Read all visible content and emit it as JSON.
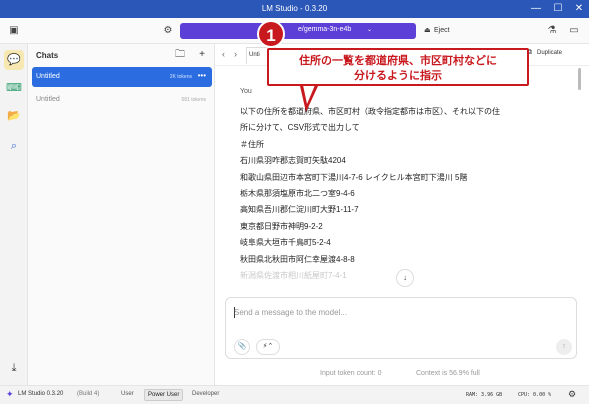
{
  "window": {
    "title": "LM Studio - 0.3.20",
    "min_icon": "—",
    "max_icon": "☐",
    "close_icon": "✕"
  },
  "toolbar": {
    "sidebar_toggle_icon": "▣",
    "settings_icon": "⚙",
    "model_name": "e/gemma-3n-e4b",
    "model_chevron": "⌄",
    "eject_icon": "⏏",
    "eject_label": "Eject",
    "accent": "#5b3fd6",
    "right_icon_1": "⚗",
    "right_icon_2": "▭"
  },
  "rail": {
    "chat_icon": "💬",
    "terminal_icon": "⌨",
    "folder_icon": "📂",
    "search_icon": "⌕",
    "download_icon": "⤓"
  },
  "chats": {
    "title": "Chats",
    "new_folder_icon": "🗀",
    "new_chat_icon": "+",
    "items": [
      {
        "name": "Untitled",
        "tokens": "2K tokens",
        "more": "•••"
      },
      {
        "name": "Untitled",
        "tokens": "581 tokens"
      }
    ]
  },
  "tabbar": {
    "prev_icon": "‹",
    "next_icon": "›",
    "tab_label": "Unti",
    "duplicate_label": "Duplicate",
    "duplicate_icon": "⧉"
  },
  "message": {
    "author": "You",
    "lines": [
      "以下の住所を都道府県、市区町村（政令指定都市は市区）、それ以下の住",
      "所に分けて、CSV形式で出力して",
      "＃住所",
      "石川県羽咋郡志賀町矢駄4204",
      "和歌山県田辺市本宮町下湯川4-7-6 レイクヒル本宮町下湯川 5階",
      "栃木県那須塩原市北二つ室9-4-6",
      "高知県吾川郡仁淀川町大野1-11-7",
      "東京都日野市神明9-2-2",
      "岐阜県大垣市千鳥町5-2-4",
      "秋田県北秋田市阿仁幸屋渡4-8-8"
    ],
    "faded_line": "新潟県佐渡市相川紙屋町7-4-1",
    "scroll_down_icon": "↓"
  },
  "composer": {
    "placeholder": "Send a message to the model...",
    "attach_icon": "📎",
    "plug_icon": "⚡⌃",
    "send_icon": "↑"
  },
  "counts": {
    "input_tokens": "Input token count:  0",
    "context": "Context is 56.9% full"
  },
  "statusbar": {
    "logo_icon": "✦",
    "app": "LM Studio 0.3.20",
    "build": "(Build 4)",
    "modes": [
      "User",
      "Power User",
      "Developer"
    ],
    "selected_mode": "Power User",
    "ram": "RAM: 3.96 GB",
    "cpu": "CPU: 0.00 %",
    "settings_icon": "⚙"
  },
  "callout": {
    "number": "1",
    "line1": "住所の一覧を都道府県、市区町村などに",
    "line2": "分けるように指示",
    "color": "#c8191f"
  }
}
